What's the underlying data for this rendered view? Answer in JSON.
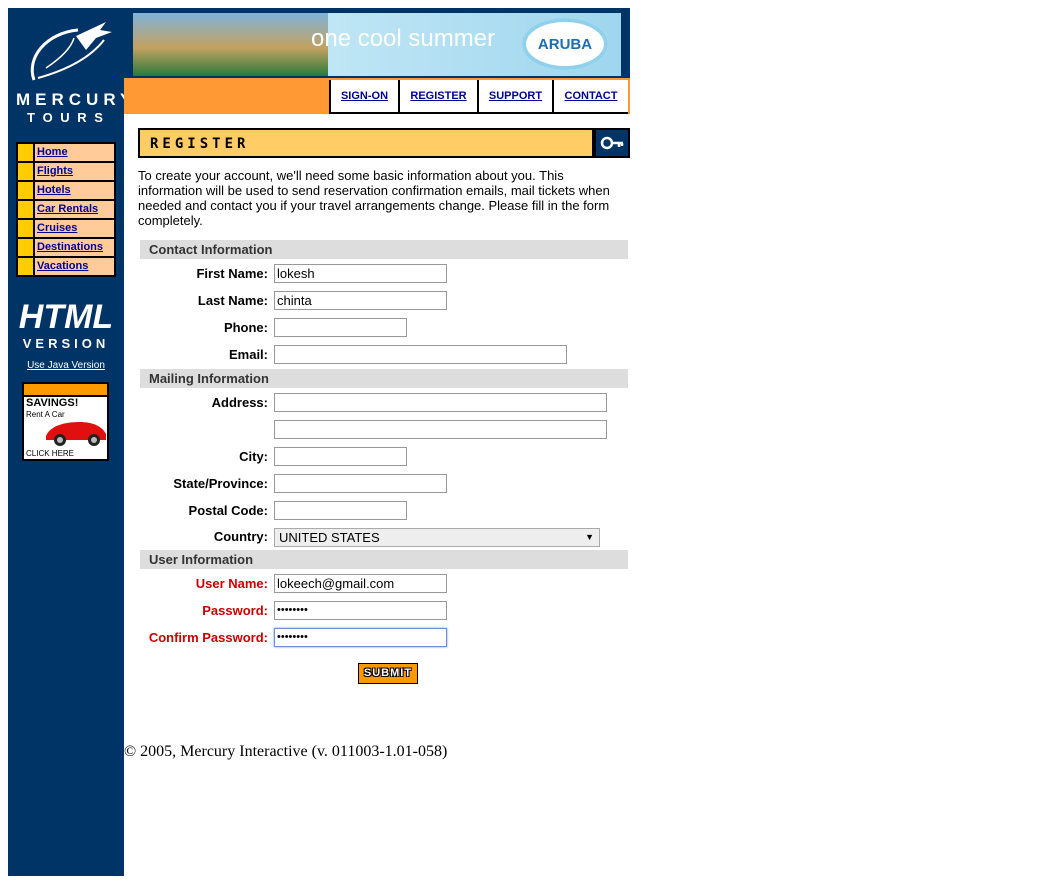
{
  "branding": {
    "logo_name": "MERCURY",
    "logo_tagline": "T O U R S",
    "html_version_line1": "HTML",
    "html_version_line2": "VERSION",
    "java_link": "Use Java Version"
  },
  "left_nav": [
    {
      "label": "Home"
    },
    {
      "label": "Flights"
    },
    {
      "label": "Hotels"
    },
    {
      "label": "Car Rentals"
    },
    {
      "label": "Cruises"
    },
    {
      "label": "Destinations"
    },
    {
      "label": "Vacations"
    }
  ],
  "ad_savings": {
    "headline": "SAVINGS!",
    "sub": "Rent A Car",
    "cta": "CLICK HERE"
  },
  "banner": {
    "title": "one cool summer",
    "logo_text": "ARUBA"
  },
  "top_nav": [
    {
      "label": "SIGN-ON"
    },
    {
      "label": "REGISTER"
    },
    {
      "label": "SUPPORT"
    },
    {
      "label": "CONTACT"
    }
  ],
  "page": {
    "heading": "REGISTER",
    "intro": "To create your account, we'll need some basic information about you. This information will be used to send reservation confirmation emails, mail tickets when needed and contact you if your travel arrangements change. Please fill in the form completely."
  },
  "contact": {
    "section_title": "Contact Information",
    "first_name_label": "First Name:",
    "first_name_value": "lokesh",
    "last_name_label": "Last Name:",
    "last_name_value": "chinta",
    "phone_label": "Phone:",
    "phone_value": "",
    "email_label": "Email:",
    "email_value": ""
  },
  "mailing": {
    "section_title": "Mailing Information",
    "address_label": "Address:",
    "address1_value": "",
    "address2_value": "",
    "city_label": "City:",
    "city_value": "",
    "state_label": "State/Province:",
    "state_value": "",
    "postal_label": "Postal Code:",
    "postal_value": "",
    "country_label": "Country:",
    "country_value": "UNITED STATES"
  },
  "user": {
    "section_title": "User Information",
    "username_label": "User Name:",
    "username_value": "lokeech@gmail.com",
    "password_label": "Password:",
    "password_value": "••••••••",
    "confirm_label": "Confirm Password:",
    "confirm_value": "••••••••"
  },
  "submit_label": "SUBMIT",
  "footer": {
    "copyright": "© 2005, Mercury Interactive (v. 011003-1.01-058)"
  },
  "colors": {
    "navy": "#003366",
    "orange": "#ff9933",
    "nav_cell": "#ffcc99",
    "link_blue": "#000099",
    "required_red": "#cc0000"
  }
}
